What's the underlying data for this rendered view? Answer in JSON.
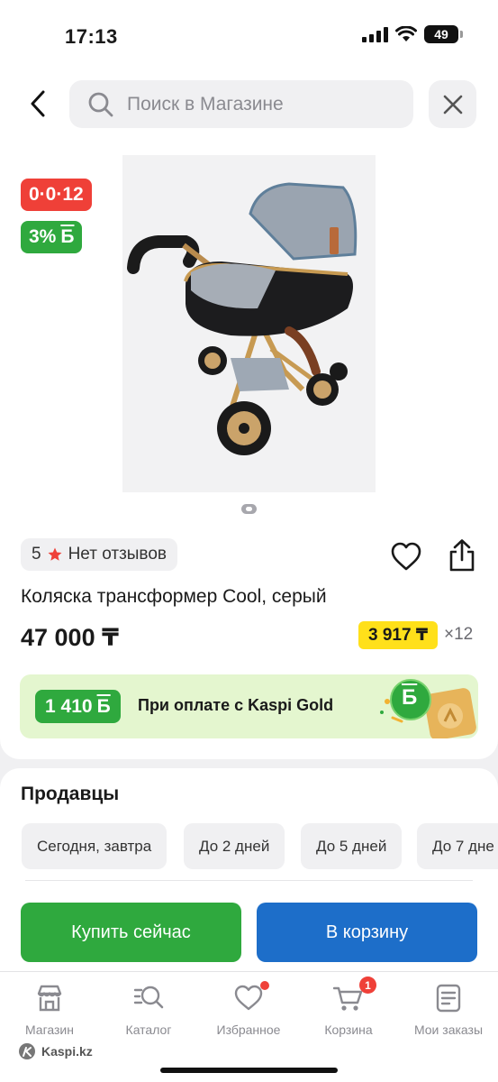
{
  "status_bar": {
    "time": "17:13",
    "battery": "49"
  },
  "search": {
    "placeholder": "Поиск в Магазине"
  },
  "product": {
    "installment_badge": "0·0·12",
    "bonus_badge": "3%",
    "bonus_symbol": "Б",
    "rating": "5",
    "reviews": "Нет отзывов",
    "title": "Коляска трансформер Cool, серый",
    "price": "47 000 ₸",
    "monthly_payment": "3 917 ₸",
    "months": "×12"
  },
  "gold_banner": {
    "amount": "1 410",
    "symbol": "Б",
    "text": "При оплате с Kaspi Gold",
    "deco_letter": "Б"
  },
  "sellers": {
    "title": "Продавцы",
    "filters": [
      "Сегодня, завтра",
      "До 2 дней",
      "До 5 дней",
      "До 7 дне"
    ]
  },
  "actions": {
    "buy_now": "Купить сейчас",
    "add_to_cart": "В корзину"
  },
  "bottom_nav": {
    "items": [
      {
        "label": "Магазин",
        "icon": "store-icon"
      },
      {
        "label": "Каталог",
        "icon": "catalog-search-icon"
      },
      {
        "label": "Избранное",
        "icon": "heart-icon"
      },
      {
        "label": "Корзина",
        "icon": "cart-icon"
      },
      {
        "label": "Мои заказы",
        "icon": "orders-icon"
      }
    ],
    "cart_count": "1"
  },
  "watermark": "Kaspi.kz",
  "colors": {
    "kaspi_red": "#ef4038",
    "kaspi_green": "#2fa93e",
    "kaspi_blue": "#1d6ec9",
    "credit_yellow": "#ffe01a",
    "gold_banner_bg": "#e4f6cf"
  }
}
